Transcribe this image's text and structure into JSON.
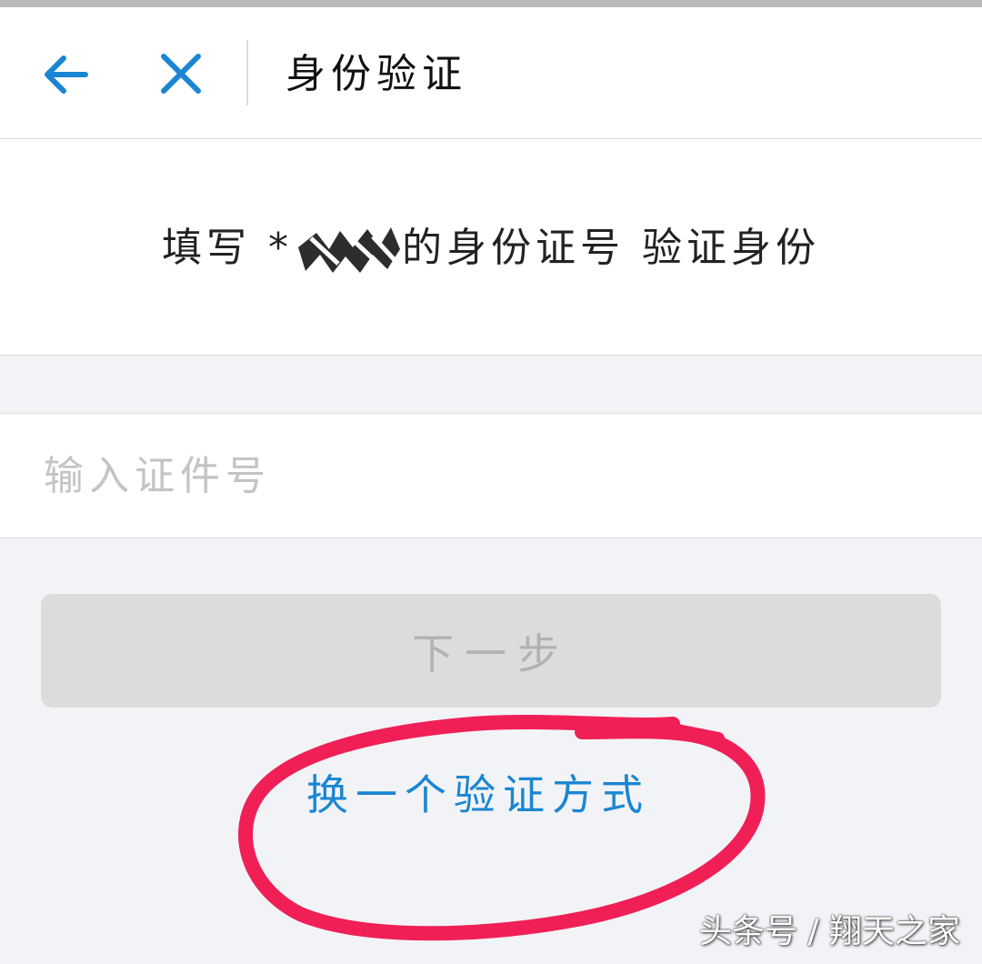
{
  "nav": {
    "title": "身份验证",
    "icons": [
      "back-arrow-icon",
      "close-icon"
    ]
  },
  "prompt": {
    "prefix": "填写 *",
    "suffix": "的身份证号 验证身份"
  },
  "id_field": {
    "placeholder": "输入证件号",
    "value": ""
  },
  "next_button": {
    "label": "下一步"
  },
  "switch_method": {
    "label": "换一个验证方式"
  },
  "watermark": {
    "text": "头条号 / 翔天之家"
  },
  "colors": {
    "accent": "#1a86d2",
    "highlight_circle": "#f01f56",
    "background": "#f2f3f7"
  }
}
